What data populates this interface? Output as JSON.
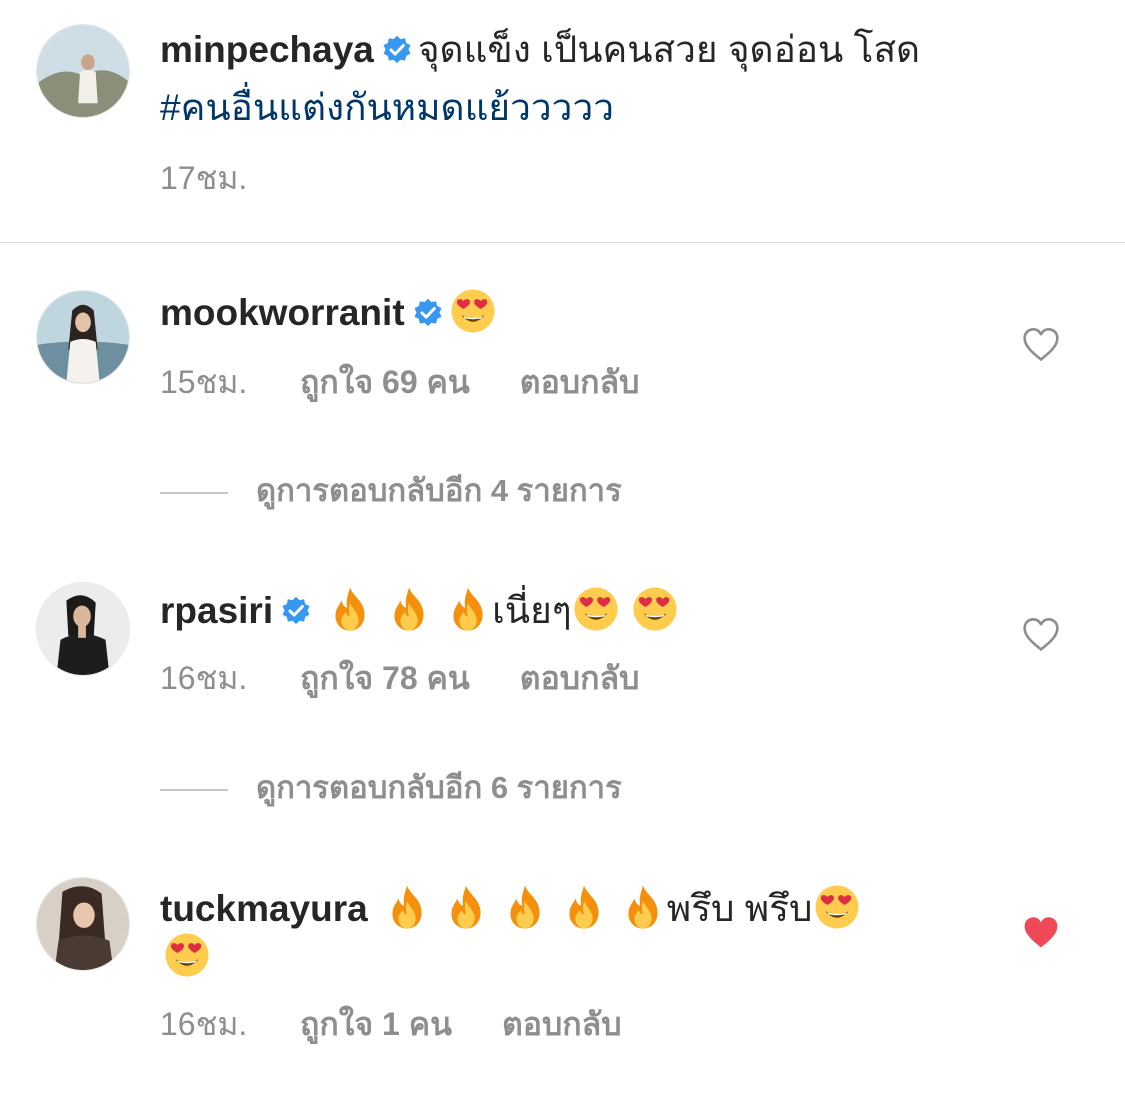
{
  "post": {
    "username": "minpechaya",
    "caption": "จุดแข็ง เป็นคนสวย จุดอ่อน  โสด",
    "hashtag": "#คนอื่นแต่งกันหมดแย้ววววว",
    "time": "17ชม."
  },
  "comments": [
    {
      "username": "mookworranit",
      "text": "",
      "time": "15ชม.",
      "likes": "ถูกใจ 69 คน",
      "reply": "ตอบกลับ",
      "view_replies": "ดูการตอบกลับอีก 4 รายการ",
      "liked": false
    },
    {
      "username": "rpasiri",
      "text": "เนี่ยๆ",
      "time": "16ชม.",
      "likes": "ถูกใจ 78 คน",
      "reply": "ตอบกลับ",
      "view_replies": "ดูการตอบกลับอีก 6 รายการ",
      "liked": false
    },
    {
      "username": "tuckmayura",
      "text": "พรึบ พรึบ",
      "time": "16ชม.",
      "likes": "ถูกใจ 1 คน",
      "reply": "ตอบกลับ",
      "liked": true
    }
  ],
  "colors": {
    "verified": "#3897f0",
    "hashtag": "#00376b",
    "muted": "#8e8e8e",
    "heart_liked": "#ed4956"
  }
}
